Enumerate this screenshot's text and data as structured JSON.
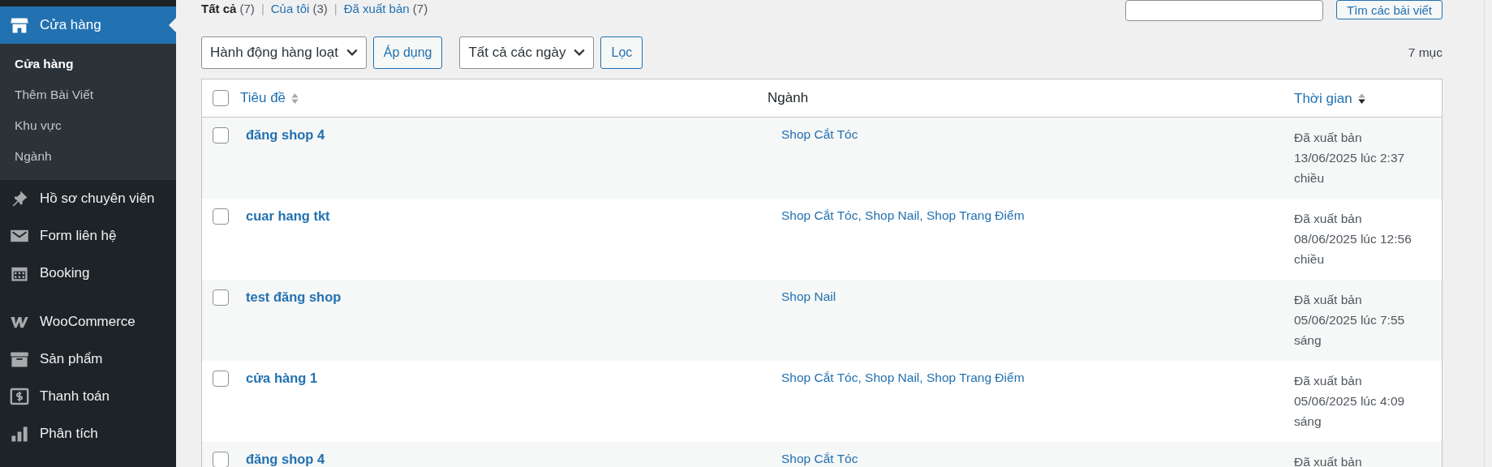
{
  "sidebar": {
    "items": [
      {
        "label": "Cửa hàng",
        "kind": "store",
        "selected": true,
        "children": [
          {
            "label": "Cửa hàng",
            "selected": true
          },
          {
            "label": "Thêm Bài Viết",
            "selected": false
          },
          {
            "label": "Khu vực",
            "selected": false
          },
          {
            "label": "Ngành",
            "selected": false
          }
        ]
      },
      {
        "label": "Hồ sơ chuyên viên",
        "kind": "pin",
        "selected": false
      },
      {
        "label": "Form liên hệ",
        "kind": "mail",
        "selected": false
      },
      {
        "label": "Booking",
        "kind": "calendar",
        "selected": false
      },
      {
        "label": "WooCommerce",
        "kind": "woo",
        "selected": false
      },
      {
        "label": "Sản phẩm",
        "kind": "box",
        "selected": false
      },
      {
        "label": "Thanh toán",
        "kind": "dollar",
        "selected": false
      },
      {
        "label": "Phân tích",
        "kind": "chart",
        "selected": false
      }
    ]
  },
  "filters": [
    {
      "label": "Tất cả",
      "count": "(7)",
      "selected": true
    },
    {
      "separator": "|",
      "label": "Của tôi",
      "count": "(3)",
      "selected": false
    },
    {
      "separator": "|",
      "label": "Đã xuất bản",
      "count": "(7)",
      "selected": false
    }
  ],
  "search": {
    "button": "Tìm các bài viết"
  },
  "bulk_action": {
    "value": "Hành động hàng loạt",
    "button": "Áp dụng"
  },
  "date_filter": {
    "value": "Tất cả các ngày",
    "button": "Lọc"
  },
  "item_count": "7 mục",
  "table": {
    "select_all_checked": false,
    "columns": [
      {
        "label": "Tiêu đề",
        "kind": "sortable",
        "sorted_desc": false
      },
      {
        "label": "Ngành",
        "kind": "plain"
      },
      {
        "label": "Thời gian",
        "kind": "sortable",
        "sorted_desc": true
      }
    ],
    "rows": [
      {
        "checked": false,
        "title": "đăng shop 4",
        "categories": "Shop Cắt Tóc",
        "status": "Đã xuất bản",
        "date": "13/06/2025 lúc 2:37 chiều"
      },
      {
        "checked": false,
        "title": "cuar hang tkt",
        "categories": "Shop Cắt Tóc, Shop Nail, Shop Trang Điểm",
        "status": "Đã xuất bản",
        "date": "08/06/2025 lúc 12:56 chiều"
      },
      {
        "checked": false,
        "title": "test đăng shop",
        "categories": "Shop Nail",
        "status": "Đã xuất bản",
        "date": "05/06/2025 lúc 7:55 sáng"
      },
      {
        "checked": false,
        "title": "cửa hàng 1",
        "categories": "Shop Cắt Tóc, Shop Nail, Shop Trang Điểm",
        "status": "Đã xuất bản",
        "date": "05/06/2025 lúc 4:09 sáng"
      },
      {
        "checked": false,
        "title": "đăng shop 4",
        "categories": "Shop Cắt Tóc",
        "status": "Đã xuất bản"
      }
    ]
  }
}
